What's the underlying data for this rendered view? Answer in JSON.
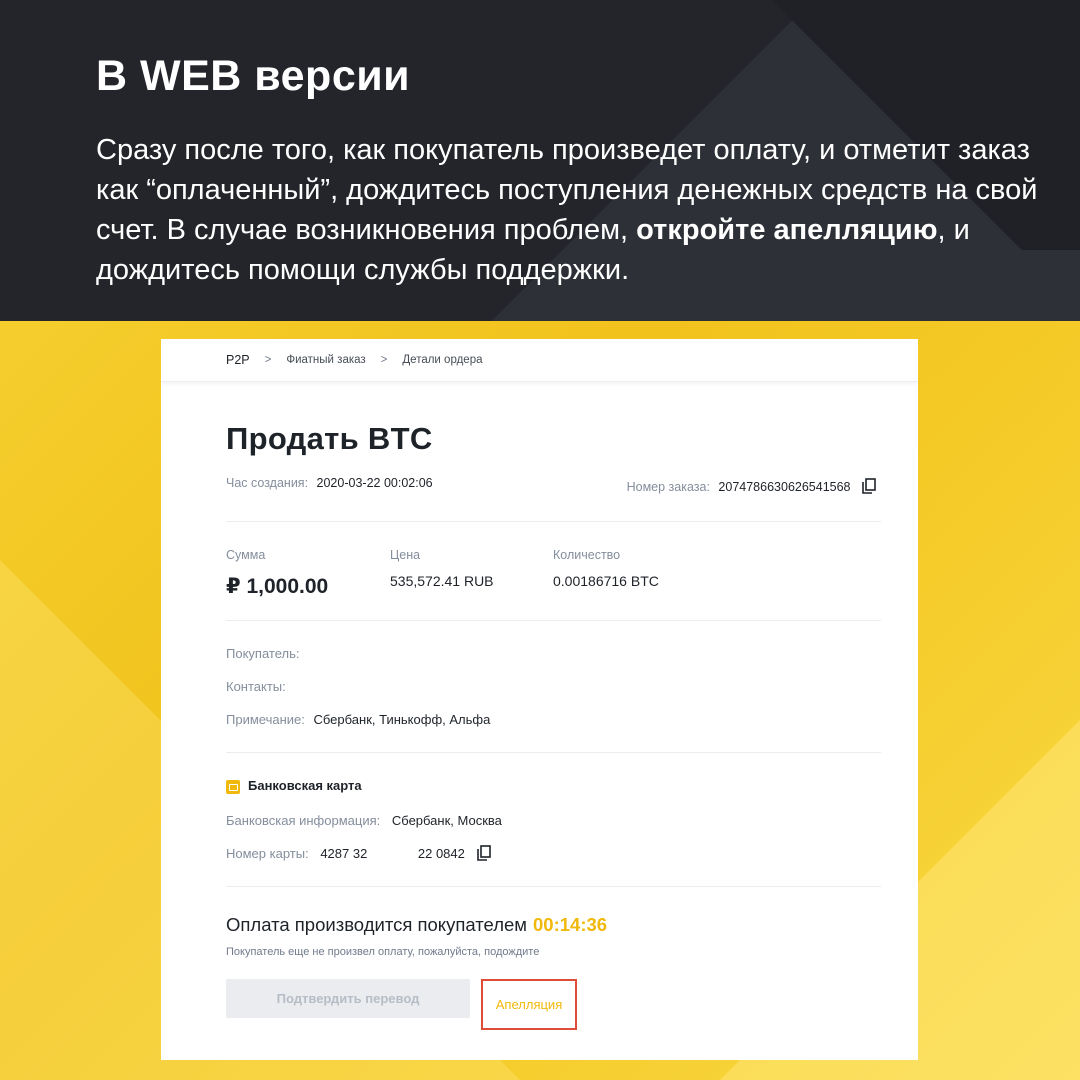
{
  "header": {
    "title": "В WEB версии",
    "text_part1": "Сразу после того, как покупатель произведет оплату, и отметит заказ как “оплаченный”, дождитесь поступления денежных средств на свой счет. В случае возникновения проблем, ",
    "text_bold": "откройте апелляцию",
    "text_part2": ", и дождитесь помощи службы поддержки."
  },
  "breadcrumb": {
    "items": [
      "P2P",
      "Фиатный заказ",
      "Детали ордера"
    ],
    "separator": ">"
  },
  "order": {
    "title": "Продать BTC",
    "created_label": "Час создания:",
    "created_value": "2020-03-22 00:02:06",
    "number_label": "Номер заказа:",
    "number_value": "20747866306265415​68",
    "amount_label": "Сумма",
    "amount_value": "₽ 1,000.00",
    "price_label": "Цена",
    "price_value": "535,572.41 RUB",
    "quantity_label": "Количество",
    "quantity_value": "0.00186716 BTC"
  },
  "counterparty": {
    "buyer_label": "Покупатель:",
    "contacts_label": "Контакты:",
    "note_label": "Примечание:",
    "note_value": "Сбербанк, Тинькофф, Альфа"
  },
  "payment": {
    "method_title": "Банковская карта",
    "bank_info_label": "Банковская информация:",
    "bank_info_value": "Сбербанк, Москва",
    "card_number_label": "Номер карты:",
    "card_number_value": "4287 32              22 0842"
  },
  "status": {
    "title": "Оплата производится покупателем",
    "timer": "00:14:36",
    "note": "Покупатель еще не произвел оплату, пожалуйста, подождите",
    "confirm_button": "Подтвердить перевод",
    "appeal_button": "Апелляция"
  },
  "colors": {
    "accent_yellow": "#f0b90b",
    "highlight_red": "#e04c3a",
    "dark_bg": "#23252b"
  }
}
